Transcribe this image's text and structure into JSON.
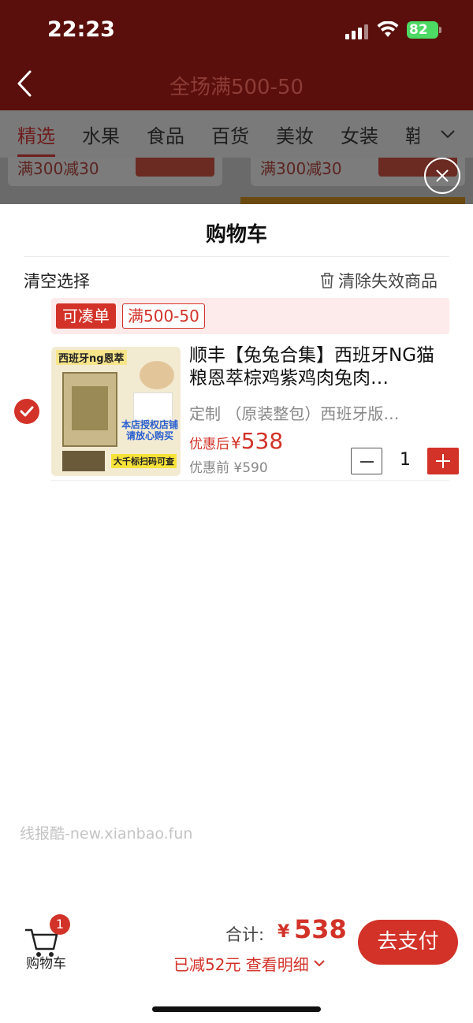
{
  "status_bar": {
    "time": "22:23",
    "battery": "82"
  },
  "header": {
    "title": "全场满500-50"
  },
  "categories": [
    "精选",
    "水果",
    "食品",
    "百货",
    "美妆",
    "女装",
    "鞋"
  ],
  "bg_cards": [
    {
      "price_text": "满300减30"
    },
    {
      "price_text": "满300减30"
    }
  ],
  "cart": {
    "title": "购物车",
    "clear_selection": "清空选择",
    "clear_invalid": "清除失效商品",
    "promo": {
      "tag": "可凑单",
      "rule": "满500-50"
    },
    "item": {
      "name": "顺丰【兔兔合集】西班牙NG猫粮恩萃棕鸡紫鸡肉兔肉…",
      "spec": "定制 （原装整包）西班牙版…",
      "price_after_label": "优惠后",
      "currency": "¥",
      "price_after": "538",
      "price_before": "优惠前 ¥590",
      "quantity": "1",
      "image_text": {
        "title": "西班牙ng恩萃",
        "note": "本店授权店铺请放心购买",
        "bottom": "大千标扫码可查"
      }
    }
  },
  "watermark": "线报酷-new.xianbao.fun",
  "footer": {
    "cart_label": "购物车",
    "cart_badge": "1",
    "total_label": "合计:",
    "currency": "¥",
    "total": "538",
    "discount": "已减52元  查看明细",
    "pay": "去支付"
  },
  "colors": {
    "accent": "#d23228",
    "header_bg": "#5a0f0c"
  }
}
